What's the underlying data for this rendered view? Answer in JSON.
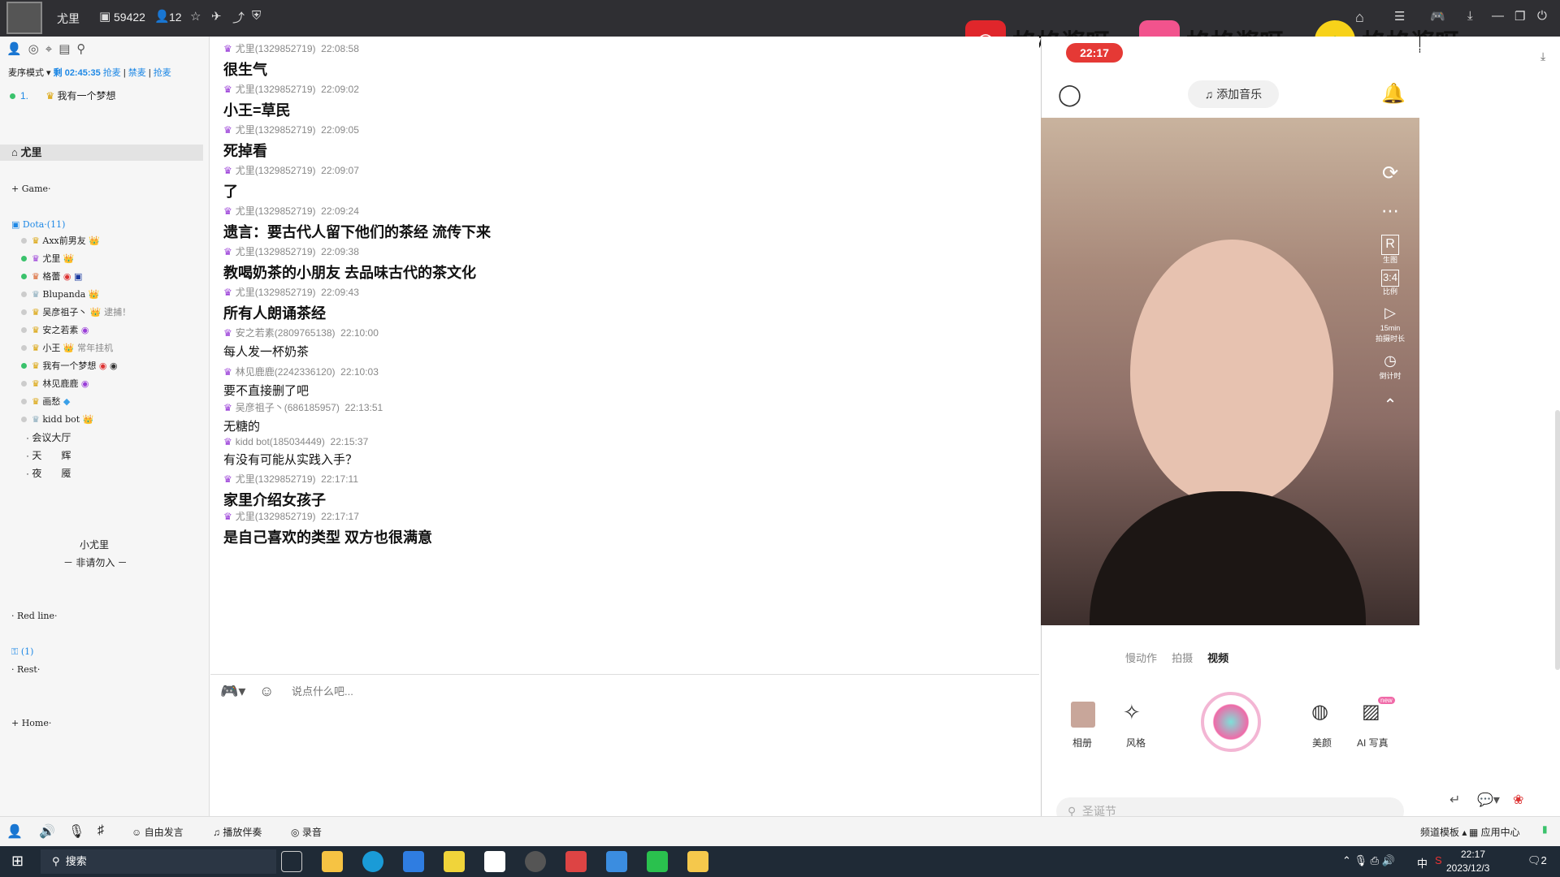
{
  "topbar": {
    "user": "尤里",
    "room_id": "59422",
    "online": "12"
  },
  "brands": {
    "netease": "格格酱呀、",
    "bilibili": "格格酱呀、",
    "qq": "格格酱呀",
    "bilibili_logo": "bilibili"
  },
  "left": {
    "mode": "麦序模式",
    "remain": "剩 02:45:35",
    "grab": "抢麦",
    "ban": "禁麦",
    "rob": "抢麦",
    "queue_item": "1.",
    "queue_name": "我有一个梦想",
    "channel_title": "尤里",
    "game": "Game·",
    "dota": "Dota·(11)",
    "members": [
      "Axx前男友",
      "尤里",
      "格蕾",
      "Blupanda",
      "吴彦祖子丶",
      "安之若素",
      "小王",
      "我有一个梦想",
      "林见鹿鹿",
      "画愁",
      "kidd bot"
    ],
    "wyzz_note": "逮捕！",
    "xw_note": "常年挂机",
    "hall": "会议大厅",
    "tian": "天　　辉",
    "ye": "夜　　魇",
    "xiaoyouli": "小尤里",
    "noenter": "－ 非请勿入 －",
    "redline": "Red line·",
    "one": "(1)",
    "rest": "Rest·",
    "home": "Home·"
  },
  "messages": [
    {
      "user": "尤里(1329852719)",
      "time": "22:08:58",
      "text": "很生气",
      "big": true
    },
    {
      "user": "尤里(1329852719)",
      "time": "22:09:02",
      "text": "小王=草民",
      "big": true
    },
    {
      "user": "尤里(1329852719)",
      "time": "22:09:05",
      "text": "死掉看",
      "big": true
    },
    {
      "user": "尤里(1329852719)",
      "time": "22:09:07",
      "text": "了",
      "big": true
    },
    {
      "user": "尤里(1329852719)",
      "time": "22:09:24",
      "text": "遗言：要古代人留下他们的茶经  流传下来",
      "big": true
    },
    {
      "user": "尤里(1329852719)",
      "time": "22:09:38",
      "text": "教喝奶茶的小朋友  去品味古代的茶文化",
      "big": true
    },
    {
      "user": "尤里(1329852719)",
      "time": "22:09:43",
      "text": "所有人朗诵茶经",
      "big": true
    },
    {
      "user": "安之若素(2809765138)",
      "time": "22:10:00",
      "text": "每人发一杯奶茶",
      "big": false
    },
    {
      "user": "林见鹿鹿(2242336120)",
      "time": "22:10:03",
      "text": "要不直接删了吧",
      "big": false
    },
    {
      "user": "吴彦祖子丶(686185957)",
      "time": "22:13:51",
      "text": "无糖的",
      "big": false
    },
    {
      "user": "kidd bot(185034449)",
      "time": "22:15:37",
      "text": "有没有可能从实践入手？",
      "big": false
    },
    {
      "user": "尤里(1329852719)",
      "time": "22:17:11",
      "text": "家里介绍女孩子",
      "big": true
    },
    {
      "user": "尤里(1329852719)",
      "time": "22:17:17",
      "text": "是自己喜欢的类型  双方也很满意",
      "big": true
    }
  ],
  "input": {
    "placeholder": "说点什么吧..."
  },
  "phone": {
    "clock": "22:17",
    "add_music": "添加音乐",
    "modes": [
      "慢动作",
      "拍摄",
      "视频"
    ],
    "album": "相册",
    "style": "风格",
    "beauty": "美颜",
    "ai": "AI 写真",
    "new": "new",
    "search": "圣诞节",
    "side": [
      "",
      "",
      "生图",
      "比例",
      "15min",
      "拍摄时长",
      "倒计时"
    ],
    "r_label": "R",
    "ratio": "3:4"
  },
  "bottombar": {
    "free": "自由发言",
    "accomp": "播放伴奏",
    "record": "录音",
    "template": "频道模板",
    "appcenter": "应用中心"
  },
  "taskbar": {
    "search": "搜索",
    "time": "22:17",
    "date": "2023/12/3",
    "ime": "中",
    "notif": "2"
  }
}
